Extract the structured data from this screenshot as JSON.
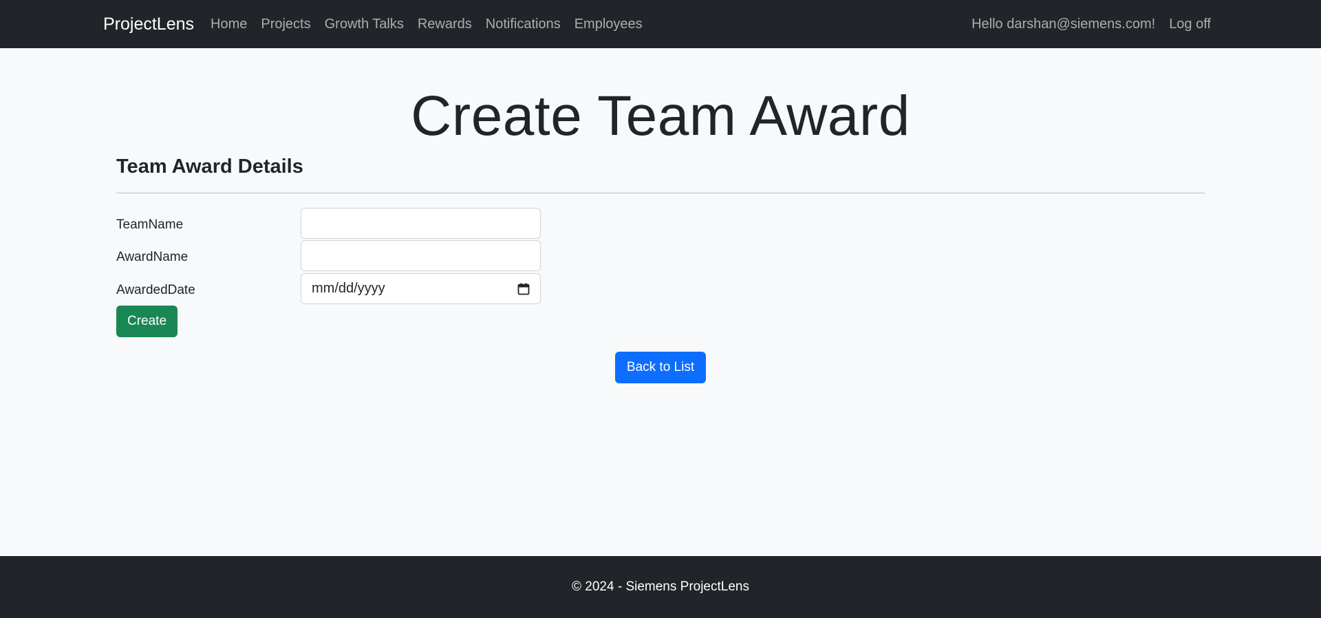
{
  "navbar": {
    "brand": "ProjectLens",
    "links": [
      "Home",
      "Projects",
      "Growth Talks",
      "Rewards",
      "Notifications",
      "Employees"
    ],
    "greeting": "Hello darshan@siemens.com!",
    "logoff": "Log off"
  },
  "page": {
    "title": "Create Team Award",
    "section_heading": "Team Award Details"
  },
  "form": {
    "team_name_label": "TeamName",
    "team_name_value": "",
    "award_name_label": "AwardName",
    "award_name_value": "",
    "awarded_date_label": "AwardedDate",
    "awarded_date_placeholder": "mm/dd/yyyy",
    "awarded_date_icon": "calendar-icon",
    "create_label": "Create",
    "create_color": "#198754"
  },
  "back_link": {
    "label": "Back to List",
    "color": "#0d6efd"
  },
  "footer": {
    "text": "© 2024 - Siemens ProjectLens"
  }
}
